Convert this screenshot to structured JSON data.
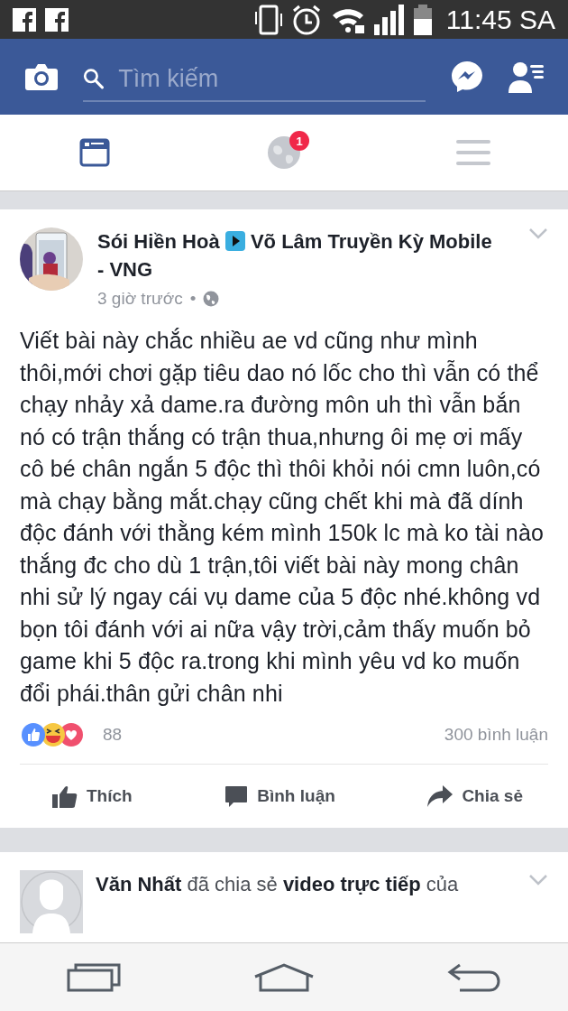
{
  "status_bar": {
    "time": "11:45 SA"
  },
  "header": {
    "search": {
      "placeholder": "Tìm kiếm"
    }
  },
  "tabs": [
    {
      "kind": "feed",
      "selected": true
    },
    {
      "kind": "notifications",
      "selected": false,
      "badge": "1"
    },
    {
      "kind": "menu",
      "selected": false
    }
  ],
  "posts": [
    {
      "author": "Sói Hiền Hoà",
      "target": "Võ Lâm Truyền Kỳ Mobile - VNG",
      "time": "3 giờ trước",
      "separator": "•",
      "body": "Viết bài này chắc nhiều ae vd cũng như mình thôi,mới chơi gặp tiêu dao nó lốc cho thì vẫn có thể chạy nhảy xả dame.ra đường môn uh thì vẫn bắn nó có trận thắng có trận thua,nhưng ôi mẹ ơi mấy cô bé chân ngắn 5 độc thì thôi khỏi nói cmn luôn,có mà chạy bằng mắt.chạy cũng chết khi mà đã dính độc đánh với thằng kém mình 150k lc mà ko tài nào thắng đc cho dù 1 trận,tôi viết bài này mong chân nhi sử lý ngay cái vụ dame của 5 độc nhé.không vd bọn tôi đánh với ai nữa vậy trời,cảm thấy muốn bỏ game khi 5 độc ra.trong khi mình yêu vd ko muốn đổi phái.thân gửi chân nhi",
      "reactions": "88",
      "comments": "300 bình luận",
      "actions": [
        {
          "kind": "like",
          "label": "Thích"
        },
        {
          "kind": "comment",
          "label": "Bình luận"
        },
        {
          "kind": "share",
          "label": "Chia sẻ"
        }
      ]
    }
  ],
  "next_post": {
    "headline": "**Văn Nhất** đã chia sẻ **video trực tiếp** của"
  }
}
